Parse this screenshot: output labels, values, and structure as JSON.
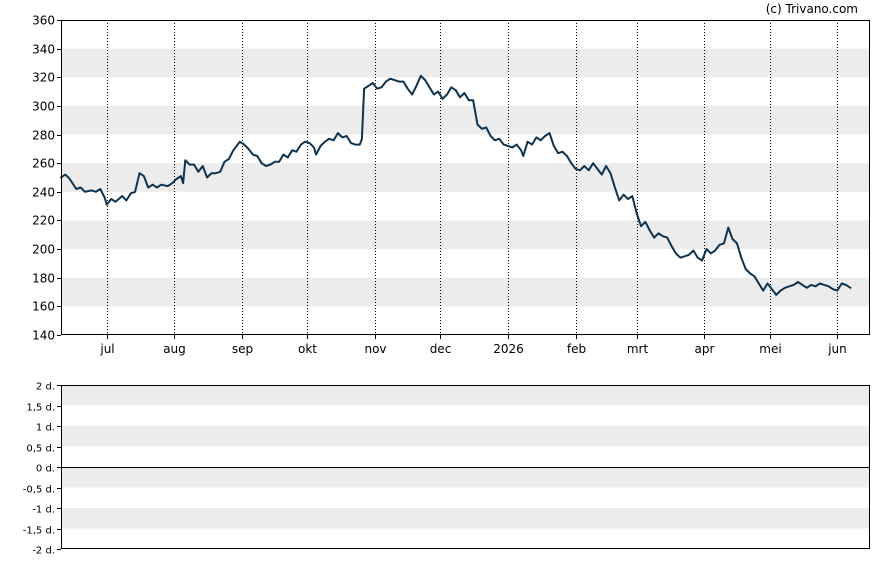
{
  "copyright": "(c) Trivano.com",
  "chart_data": [
    {
      "type": "line",
      "ylim": [
        140,
        360
      ],
      "yticks": [
        140,
        160,
        180,
        200,
        220,
        240,
        260,
        280,
        300,
        320,
        340,
        360
      ],
      "x_start": "2025-06-10",
      "x_end": "2026-06-16",
      "month_ticks": [
        {
          "date": "2025-07-01",
          "label": "jul"
        },
        {
          "date": "2025-08-01",
          "label": "aug"
        },
        {
          "date": "2025-09-01",
          "label": "sep"
        },
        {
          "date": "2025-10-01",
          "label": "okt"
        },
        {
          "date": "2025-11-01",
          "label": "nov"
        },
        {
          "date": "2025-12-01",
          "label": "dec"
        },
        {
          "date": "2026-01-01",
          "label": "2026"
        },
        {
          "date": "2026-02-01",
          "label": "feb"
        },
        {
          "date": "2026-03-01",
          "label": "mrt"
        },
        {
          "date": "2026-04-01",
          "label": "apr"
        },
        {
          "date": "2026-05-01",
          "label": "mei"
        },
        {
          "date": "2026-06-01",
          "label": "jun"
        }
      ],
      "grid": "alternating horizontal bands, dotted vertical month lines",
      "line_color": "#0d3350",
      "series": [
        {
          "points": [
            [
              "2025-06-10",
              250
            ],
            [
              "2025-06-12",
              252
            ],
            [
              "2025-06-14",
              249
            ],
            [
              "2025-06-17",
              242
            ],
            [
              "2025-06-19",
              243
            ],
            [
              "2025-06-21",
              240
            ],
            [
              "2025-06-24",
              241
            ],
            [
              "2025-06-26",
              240
            ],
            [
              "2025-06-28",
              242
            ],
            [
              "2025-06-30",
              236
            ],
            [
              "2025-07-01",
              231
            ],
            [
              "2025-07-03",
              235
            ],
            [
              "2025-07-05",
              233
            ],
            [
              "2025-07-08",
              237
            ],
            [
              "2025-07-10",
              234
            ],
            [
              "2025-07-12",
              239
            ],
            [
              "2025-07-14",
              240
            ],
            [
              "2025-07-16",
              253
            ],
            [
              "2025-07-18",
              251
            ],
            [
              "2025-07-20",
              243
            ],
            [
              "2025-07-22",
              245
            ],
            [
              "2025-07-24",
              243
            ],
            [
              "2025-07-26",
              245
            ],
            [
              "2025-07-29",
              244
            ],
            [
              "2025-07-31",
              246
            ],
            [
              "2025-08-02",
              249
            ],
            [
              "2025-08-04",
              251
            ],
            [
              "2025-08-05",
              246
            ],
            [
              "2025-08-06",
              262
            ],
            [
              "2025-08-08",
              259
            ],
            [
              "2025-08-10",
              259
            ],
            [
              "2025-08-12",
              254
            ],
            [
              "2025-08-14",
              258
            ],
            [
              "2025-08-16",
              250
            ],
            [
              "2025-08-18",
              253
            ],
            [
              "2025-08-20",
              253
            ],
            [
              "2025-08-22",
              254
            ],
            [
              "2025-08-24",
              261
            ],
            [
              "2025-08-26",
              263
            ],
            [
              "2025-08-28",
              269
            ],
            [
              "2025-08-31",
              275
            ],
            [
              "2025-09-02",
              273
            ],
            [
              "2025-09-04",
              270
            ],
            [
              "2025-09-06",
              266
            ],
            [
              "2025-09-08",
              265
            ],
            [
              "2025-09-10",
              260
            ],
            [
              "2025-09-12",
              258
            ],
            [
              "2025-09-14",
              259
            ],
            [
              "2025-09-16",
              261
            ],
            [
              "2025-09-18",
              261
            ],
            [
              "2025-09-20",
              266
            ],
            [
              "2025-09-22",
              264
            ],
            [
              "2025-09-24",
              269
            ],
            [
              "2025-09-26",
              268
            ],
            [
              "2025-09-28",
              273
            ],
            [
              "2025-09-30",
              275
            ],
            [
              "2025-10-02",
              274
            ],
            [
              "2025-10-04",
              271
            ],
            [
              "2025-10-05",
              266
            ],
            [
              "2025-10-07",
              272
            ],
            [
              "2025-10-09",
              275
            ],
            [
              "2025-10-11",
              277
            ],
            [
              "2025-10-13",
              276
            ],
            [
              "2025-10-15",
              281
            ],
            [
              "2025-10-17",
              278
            ],
            [
              "2025-10-19",
              279
            ],
            [
              "2025-10-21",
              274
            ],
            [
              "2025-10-23",
              273
            ],
            [
              "2025-10-25",
              273
            ],
            [
              "2025-10-26",
              277
            ],
            [
              "2025-10-27",
              312
            ],
            [
              "2025-10-29",
              314
            ],
            [
              "2025-10-31",
              316
            ],
            [
              "2025-11-02",
              312
            ],
            [
              "2025-11-04",
              313
            ],
            [
              "2025-11-06",
              317
            ],
            [
              "2025-11-08",
              319
            ],
            [
              "2025-11-10",
              318
            ],
            [
              "2025-11-12",
              317
            ],
            [
              "2025-11-14",
              317
            ],
            [
              "2025-11-16",
              312
            ],
            [
              "2025-11-18",
              308
            ],
            [
              "2025-11-20",
              314
            ],
            [
              "2025-11-22",
              321
            ],
            [
              "2025-11-24",
              318
            ],
            [
              "2025-11-26",
              313
            ],
            [
              "2025-11-28",
              308
            ],
            [
              "2025-11-30",
              310
            ],
            [
              "2025-12-02",
              305
            ],
            [
              "2025-12-04",
              308
            ],
            [
              "2025-12-06",
              313
            ],
            [
              "2025-12-08",
              311
            ],
            [
              "2025-12-10",
              306
            ],
            [
              "2025-12-12",
              309
            ],
            [
              "2025-12-14",
              304
            ],
            [
              "2025-12-16",
              304
            ],
            [
              "2025-12-18",
              287
            ],
            [
              "2025-12-20",
              284
            ],
            [
              "2025-12-22",
              285
            ],
            [
              "2025-12-24",
              279
            ],
            [
              "2025-12-26",
              276
            ],
            [
              "2025-12-28",
              277
            ],
            [
              "2025-12-30",
              273
            ],
            [
              "2026-01-01",
              272
            ],
            [
              "2026-01-03",
              271
            ],
            [
              "2026-01-05",
              273
            ],
            [
              "2026-01-07",
              269
            ],
            [
              "2026-01-08",
              265
            ],
            [
              "2026-01-10",
              275
            ],
            [
              "2026-01-12",
              273
            ],
            [
              "2026-01-14",
              278
            ],
            [
              "2026-01-16",
              276
            ],
            [
              "2026-01-18",
              279
            ],
            [
              "2026-01-20",
              281
            ],
            [
              "2026-01-22",
              272
            ],
            [
              "2026-01-24",
              267
            ],
            [
              "2026-01-26",
              268
            ],
            [
              "2026-01-28",
              265
            ],
            [
              "2026-01-30",
              260
            ],
            [
              "2026-02-01",
              256
            ],
            [
              "2026-02-03",
              255
            ],
            [
              "2026-02-05",
              258
            ],
            [
              "2026-02-07",
              255
            ],
            [
              "2026-02-09",
              260
            ],
            [
              "2026-02-11",
              256
            ],
            [
              "2026-02-13",
              252
            ],
            [
              "2026-02-15",
              258
            ],
            [
              "2026-02-17",
              253
            ],
            [
              "2026-02-19",
              243
            ],
            [
              "2026-02-21",
              234
            ],
            [
              "2026-02-23",
              238
            ],
            [
              "2026-02-25",
              235
            ],
            [
              "2026-02-27",
              237
            ],
            [
              "2026-03-01",
              225
            ],
            [
              "2026-03-03",
              216
            ],
            [
              "2026-03-05",
              219
            ],
            [
              "2026-03-07",
              213
            ],
            [
              "2026-03-09",
              208
            ],
            [
              "2026-03-11",
              211
            ],
            [
              "2026-03-13",
              209
            ],
            [
              "2026-03-15",
              208
            ],
            [
              "2026-03-17",
              202
            ],
            [
              "2026-03-19",
              197
            ],
            [
              "2026-03-21",
              194
            ],
            [
              "2026-03-23",
              195
            ],
            [
              "2026-03-25",
              196
            ],
            [
              "2026-03-27",
              199
            ],
            [
              "2026-03-29",
              194
            ],
            [
              "2026-03-31",
              192
            ],
            [
              "2026-04-02",
              200
            ],
            [
              "2026-04-04",
              197
            ],
            [
              "2026-04-06",
              199
            ],
            [
              "2026-04-08",
              203
            ],
            [
              "2026-04-10",
              204
            ],
            [
              "2026-04-12",
              215
            ],
            [
              "2026-04-14",
              207
            ],
            [
              "2026-04-16",
              204
            ],
            [
              "2026-04-18",
              194
            ],
            [
              "2026-04-20",
              186
            ],
            [
              "2026-04-22",
              183
            ],
            [
              "2026-04-24",
              181
            ],
            [
              "2026-04-26",
              176
            ],
            [
              "2026-04-28",
              171
            ],
            [
              "2026-04-30",
              176
            ],
            [
              "2026-05-02",
              172
            ],
            [
              "2026-05-04",
              168
            ],
            [
              "2026-05-06",
              171
            ],
            [
              "2026-05-08",
              173
            ],
            [
              "2026-05-10",
              174
            ],
            [
              "2026-05-12",
              175
            ],
            [
              "2026-05-14",
              177
            ],
            [
              "2026-05-16",
              175
            ],
            [
              "2026-05-18",
              173
            ],
            [
              "2026-05-20",
              175
            ],
            [
              "2026-05-22",
              174
            ],
            [
              "2026-05-24",
              176
            ],
            [
              "2026-05-26",
              175
            ],
            [
              "2026-05-28",
              174
            ],
            [
              "2026-05-30",
              172
            ],
            [
              "2026-06-01",
              171
            ],
            [
              "2026-06-03",
              176
            ],
            [
              "2026-06-05",
              175
            ],
            [
              "2026-06-07",
              173
            ]
          ]
        }
      ]
    },
    {
      "type": "line",
      "ylim": [
        -2,
        2
      ],
      "ytick_labels": [
        {
          "value": 2,
          "label": "2 d."
        },
        {
          "value": 1.5,
          "label": "1,5 d."
        },
        {
          "value": 1,
          "label": "1 d."
        },
        {
          "value": 0.5,
          "label": "0,5 d."
        },
        {
          "value": 0,
          "label": "0 d."
        },
        {
          "value": -0.5,
          "label": "-0,5 d."
        },
        {
          "value": -1,
          "label": "-1 d."
        },
        {
          "value": -1.5,
          "label": "-1,5 d."
        },
        {
          "value": -2,
          "label": "-2 d."
        }
      ],
      "grid": "alternating horizontal bands, zero line",
      "series": []
    }
  ]
}
